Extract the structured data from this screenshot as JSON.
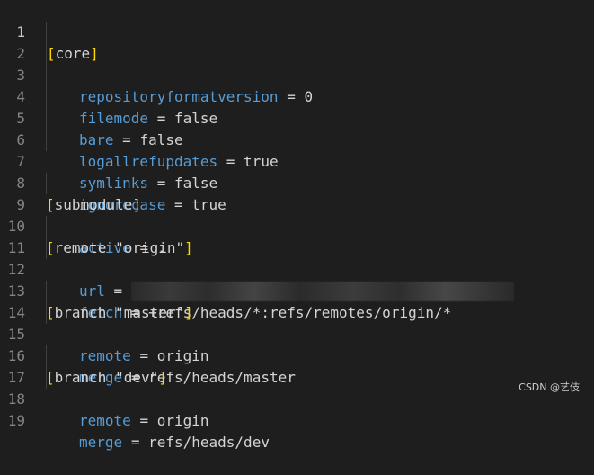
{
  "editor": {
    "lines": [
      {
        "num": "1",
        "section_name": "core"
      },
      {
        "num": "2",
        "key": "repositoryformatversion",
        "eq": "=",
        "value": "0"
      },
      {
        "num": "3",
        "key": "filemode",
        "eq": "=",
        "value": "false"
      },
      {
        "num": "4",
        "key": "bare",
        "eq": "=",
        "value": "false"
      },
      {
        "num": "5",
        "key": "logallrefupdates",
        "eq": "=",
        "value": "true"
      },
      {
        "num": "6",
        "key": "symlinks",
        "eq": "=",
        "value": "false"
      },
      {
        "num": "7",
        "key": "ignorecase",
        "eq": "=",
        "value": "true"
      },
      {
        "num": "8",
        "section_name": "submodule"
      },
      {
        "num": "9",
        "key": "active",
        "eq": "=",
        "value": "."
      },
      {
        "num": "10",
        "section_name": "remote \"origin\""
      },
      {
        "num": "11",
        "key": "url",
        "eq": "=",
        "value": ""
      },
      {
        "num": "12",
        "key": "fetch",
        "eq": "=",
        "value": "+refs/heads/*:refs/remotes/origin/*"
      },
      {
        "num": "13",
        "section_name": "branch \"master\""
      },
      {
        "num": "14",
        "key": "remote",
        "eq": "=",
        "value": "origin"
      },
      {
        "num": "15",
        "key": "merge",
        "eq": "=",
        "value": "refs/heads/master"
      },
      {
        "num": "16",
        "section_name": "branch \"dev\""
      },
      {
        "num": "17",
        "key": "remote",
        "eq": "=",
        "value": "origin"
      },
      {
        "num": "18",
        "key": "merge",
        "eq": "=",
        "value": "refs/heads/dev"
      },
      {
        "num": "19"
      }
    ]
  },
  "watermark": "CSDN @艺伎",
  "colors": {
    "background": "#1e1e1e",
    "key": "#569cd6",
    "bracket": "#ffd700",
    "text": "#d4d4d4",
    "line_number": "#858585"
  }
}
